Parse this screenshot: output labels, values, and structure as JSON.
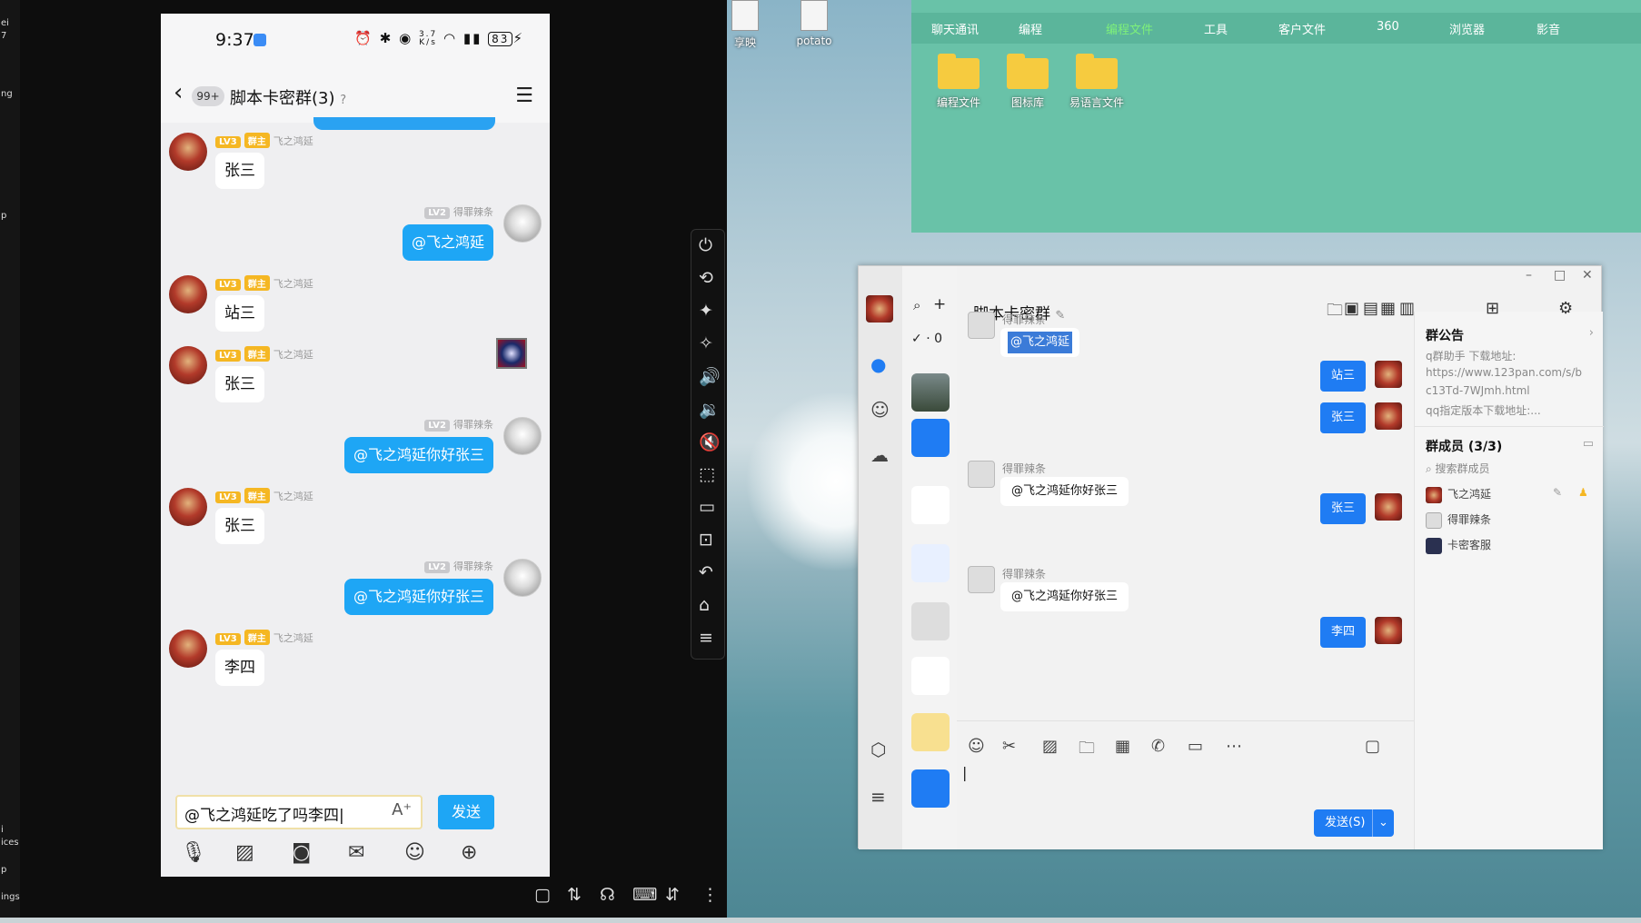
{
  "left_strip": {
    "top_a": "ei",
    "top_b": "7",
    "mid_a": "ng",
    "mid_b": "p",
    "bot_a": "i",
    "bot_b": "ices",
    "bot_c": "p",
    "bot_d": "ings"
  },
  "phone": {
    "status": {
      "time": "9:37",
      "net_speed_top": "3.7",
      "net_speed_unit": "K/s",
      "battery": "83"
    },
    "chat": {
      "badge": "99+",
      "title": "脚本卡密群(3)",
      "messages": [
        {
          "side": "left",
          "level": "LV3",
          "role": "群主",
          "name": "飞之鸿延",
          "text": "张三"
        },
        {
          "side": "right",
          "level": "LV2",
          "name": "得罪辣条",
          "text": "@飞之鸿延"
        },
        {
          "side": "left",
          "level": "LV3",
          "role": "群主",
          "name": "飞之鸿延",
          "text": "站三"
        },
        {
          "side": "left",
          "level": "LV3",
          "role": "群主",
          "name": "飞之鸿延",
          "text": "张三"
        },
        {
          "side": "right",
          "level": "LV2",
          "name": "得罪辣条",
          "text": "@飞之鸿延你好张三"
        },
        {
          "side": "left",
          "level": "LV3",
          "role": "群主",
          "name": "飞之鸿延",
          "text": "张三"
        },
        {
          "side": "right",
          "level": "LV2",
          "name": "得罪辣条",
          "text": "@飞之鸿延你好张三"
        },
        {
          "side": "left",
          "level": "LV3",
          "role": "群主",
          "name": "飞之鸿延",
          "text": "李四"
        }
      ],
      "input_value": "@飞之鸿延吃了吗李四",
      "send_label": "发送"
    }
  },
  "desktop": {
    "icons": [
      {
        "label": "享映"
      },
      {
        "label": "potato"
      }
    ],
    "folder_window": {
      "tabs": [
        "聊天通讯",
        "编程",
        "编程文件",
        "工具",
        "客户文件",
        "360",
        "浏览器",
        "影音"
      ],
      "active_tab": "编程文件",
      "items": [
        {
          "label": "编程文件"
        },
        {
          "label": "图标库"
        },
        {
          "label": "易语言文件"
        }
      ]
    }
  },
  "qq": {
    "status_count": "· 0",
    "group_title": "脚本卡密群",
    "messages": [
      {
        "side": "left",
        "name": "得罪辣条",
        "text": "@飞之鸿延",
        "selected": true
      },
      {
        "side": "right",
        "text": "站三"
      },
      {
        "side": "right",
        "text": "张三"
      },
      {
        "side": "left",
        "name": "得罪辣条",
        "text": "@飞之鸿延你好张三"
      },
      {
        "side": "right",
        "text": "张三"
      },
      {
        "side": "left",
        "name": "得罪辣条",
        "text": "@飞之鸿延你好张三"
      },
      {
        "side": "right",
        "text": "李四"
      }
    ],
    "send_label": "发送(S)",
    "announcement": {
      "header": "群公告",
      "lines": [
        "q群助手 下载地址:",
        "https://www.123pan.com/s/b",
        "c13Td-7WJmh.html",
        "qq指定版本下载地址:..."
      ]
    },
    "members": {
      "header": "群成员 (3/3)",
      "search_placeholder": "搜索群成员",
      "list": [
        {
          "name": "飞之鸿延"
        },
        {
          "name": "得罪辣条"
        },
        {
          "name": "卡密客服"
        }
      ]
    }
  }
}
